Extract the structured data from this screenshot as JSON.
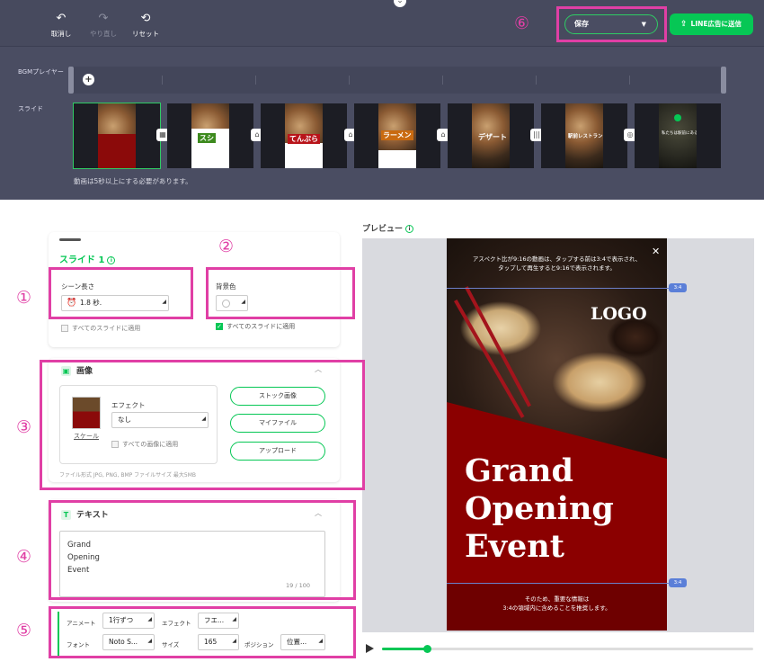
{
  "toolbar": {
    "undo_label": "取消し",
    "redo_label": "やり直し",
    "reset_label": "リセット",
    "save_select_value": "保存",
    "send_label": "LINE広告に送信"
  },
  "timeline": {
    "bgm_label": "BGMプレイヤー",
    "slide_row_label": "スライド",
    "warning": "動画は5秒以上にする必要があります。",
    "thumb_labels": [
      "スシ",
      "てんぷら",
      "ラーメン",
      "デザート",
      "駅前レストラン",
      "私たちは駅前にある！"
    ]
  },
  "slide_panel": {
    "title": "スライド 1",
    "scene_length_label": "シーン長さ",
    "scene_length_value": "1.8 秒.",
    "bg_color_label": "背景色",
    "apply_all_label": "すべてのスライドに適用",
    "apply_all_bg_label": "すべてのスライドに適用"
  },
  "image_panel": {
    "title": "画像",
    "effect_label": "エフェクト",
    "effect_value": "なし",
    "scale_label": "スケール",
    "apply_all_images_label": "すべての画像に適用",
    "stock_button": "ストック画像",
    "myfile_button": "マイファイル",
    "upload_button": "アップロード",
    "hint": "ファイル形式 JPG, PNG, BMP ファイルサイズ 最大5MB"
  },
  "text_panel": {
    "title": "テキスト",
    "lines": [
      "Grand",
      "Opening",
      "Event"
    ],
    "counter": "19 / 100"
  },
  "props_panel": {
    "animation_label": "アニメート",
    "animation_value": "1行ずつ",
    "effect_label": "エフェクト",
    "effect_value": "フエ...",
    "font_label": "フォント",
    "font_value": "Noto S...",
    "size_label": "サイズ",
    "size_value": "165",
    "position_label": "ポジション",
    "position_value": "位置..."
  },
  "preview": {
    "label": "プレビュー",
    "top_note_line1": "アスペクト比が9:16の動画は、タップする前は3:4で表示され、",
    "top_note_line2": "タップして再生すると9:16で表示されます。",
    "logo": "LOGO",
    "headline_lines": [
      "Grand",
      "Opening",
      "Event"
    ],
    "bottom_note_line1": "そのため、重要な情報は",
    "bottom_note_line2": "3:4の領域内に含めることを推奨します。",
    "ratio_tag_top": "3:4",
    "ratio_tag_bottom": "3:4",
    "progress_fraction": 0.12
  },
  "annotations": {
    "n1": "①",
    "n2": "②",
    "n3": "③",
    "n4": "④",
    "n5": "⑤",
    "n6": "⑥"
  },
  "colors": {
    "accent": "#06c755",
    "annotation": "#e03fa5",
    "editor_bg": "#4a4d62",
    "preview_red": "#8b0000"
  },
  "icons": {
    "undo": "undo-icon",
    "redo": "redo-icon",
    "reset": "reset-icon",
    "send": "share-icon",
    "add": "plus-icon"
  }
}
